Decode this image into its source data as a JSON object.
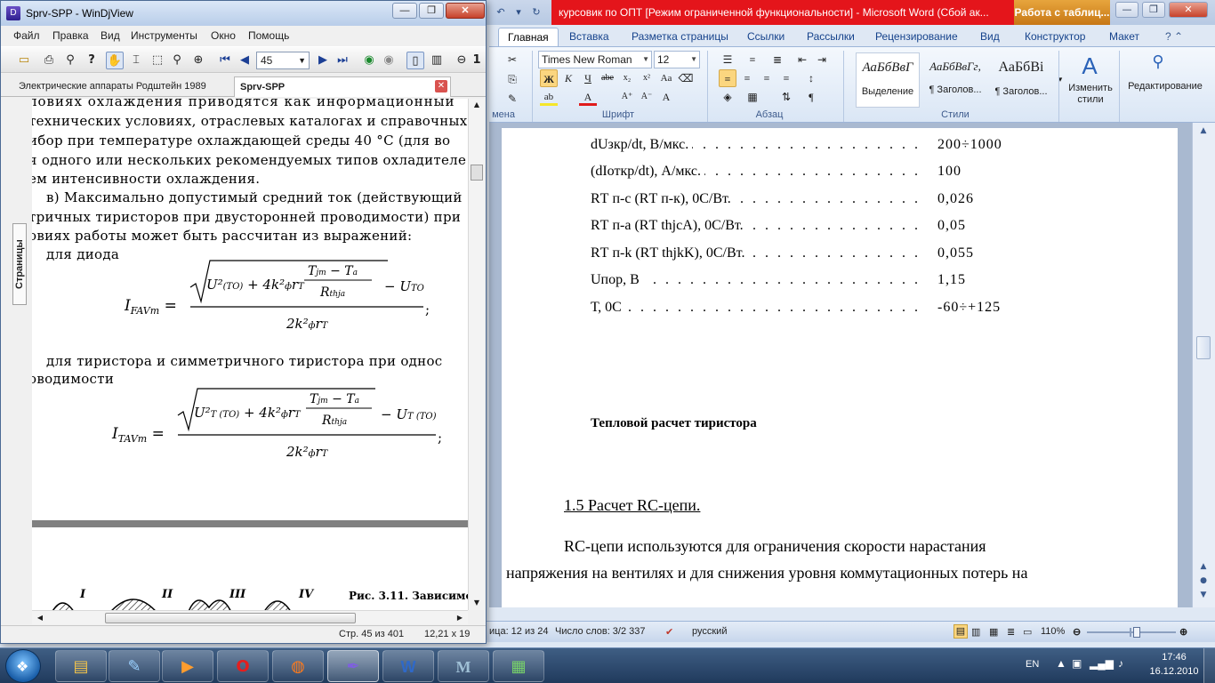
{
  "word": {
    "title": "курсовик по ОПТ [Режим ограниченной функциональности] - Microsoft Word (Сбой ак...",
    "context_tab": "Работа с таблиц...",
    "tabs": [
      "Главная",
      "Вставка",
      "Разметка страницы",
      "Ссылки",
      "Рассылки",
      "Рецензирование",
      "Вид",
      "Конструктор",
      "Макет"
    ],
    "font_name": "Times New Roman",
    "font_size": "12",
    "group_labels": {
      "clipboard": "мена",
      "font": "Шрифт",
      "paragraph": "Абзац",
      "styles": "Стили"
    },
    "styles": [
      {
        "sample": "АаБбВвГ",
        "name": "Выделение"
      },
      {
        "sample": "АаБбВвГг,",
        "name": "¶ Заголов..."
      },
      {
        "sample": "АаБбВі",
        "name": "¶ Заголов..."
      }
    ],
    "change_styles": "Изменить стили",
    "editing": "Редактирование",
    "specs": [
      {
        "name": "dUзкр/dt, В/мкс.",
        "value": "200÷1000"
      },
      {
        "name": "(dIоткр/dt), А/мкс.",
        "value": "100"
      },
      {
        "name": "RТ п-с (RТ п-к), 0С/Вт.",
        "value": "0,026"
      },
      {
        "name": "RТ п-а (RТ thjcA), 0С/Вт.",
        "value": "0,05"
      },
      {
        "name": "RТ п-k (RТ thjkK), 0С/Вт.",
        "value": "0,055"
      },
      {
        "name": "Uпор, В",
        "value": "1,15"
      },
      {
        "name": "Т, 0С",
        "value": "-60÷+125"
      }
    ],
    "heading": "Тепловой расчет тиристора",
    "subheading": "1.5 Расчет RC-цепи.",
    "para_line1": "RC-цепи используются для ограничения скорости нарастания",
    "para_line2": "напряжения на вентилях и для снижения уровня коммутационных потерь на",
    "status": {
      "pages": "ица: 12 из 24",
      "words": "Число слов: 3/2 337",
      "language": "русский",
      "zoom": "110%"
    }
  },
  "djview": {
    "title": "Sprv-SPP - WinDjView",
    "menu": [
      "Файл",
      "Правка",
      "Вид",
      "Инструменты",
      "Окно",
      "Помощь"
    ],
    "page_number": "45",
    "tabs": [
      "Электрические аппараты Родштейн 1989",
      "Sprv-SPP"
    ],
    "side_label": "Страницы",
    "text_lines": [
      "ловиях охлаждения приводятся как информационный",
      "технических условиях, отраслевых каталогах и справочных д",
      "ибор при температуре охлаждающей среды 40 °С (для во",
      "я одного или нескольких рекомендуемых типов охладителе",
      "ем интенсивности охлаждения.",
      "в) Максимально допустимый средний ток (действующий",
      "тричных тиристоров при двусторонней проводимости) при",
      "овиях работы может быть рассчитан из выражений:",
      "для диода",
      "для тиристора и симметричного тиристора при однос",
      "оводимости"
    ],
    "figure_caption": "Рис. 3.11. Зависимо",
    "figure_labels": [
      "I",
      "II",
      "III",
      "IV"
    ],
    "status_page": "Стр. 45 из 401",
    "status_size": "12,21 x 19"
  },
  "taskbar": {
    "language": "EN",
    "time": "17:46",
    "date": "16.12.2010"
  },
  "colors": {
    "word_title_bg": "#e4151b",
    "context_tab_bg": "#d08a20",
    "taskbar_bg": "#203a5c"
  }
}
